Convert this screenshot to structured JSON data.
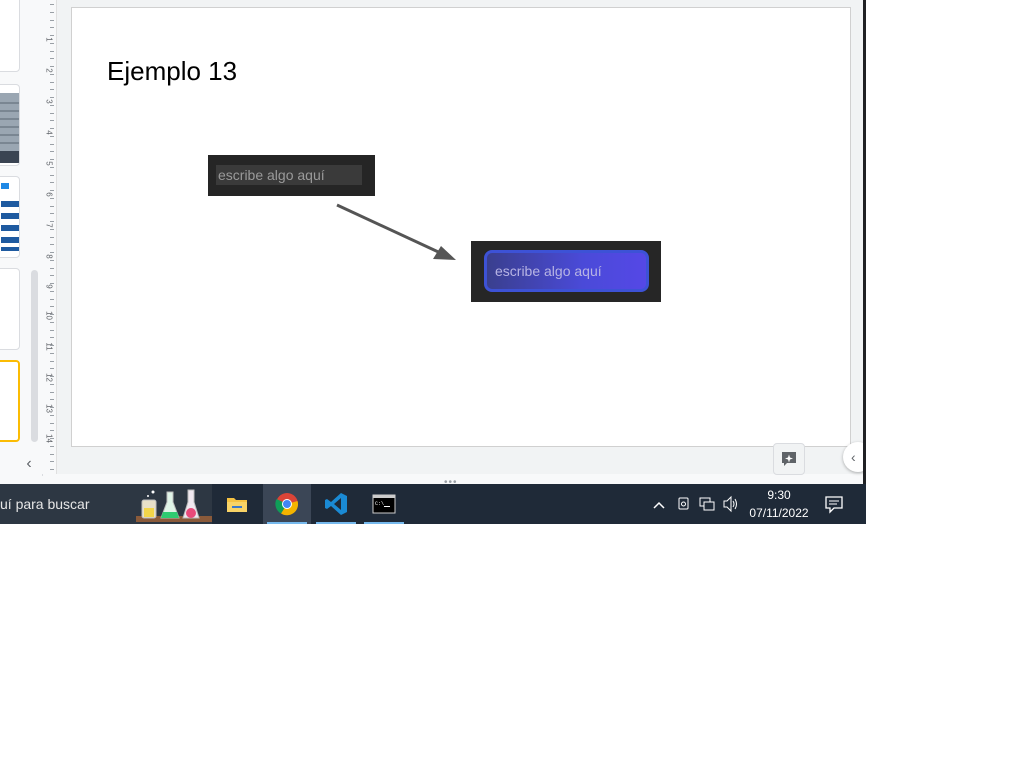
{
  "slide": {
    "title": "Ejemplo 13",
    "input_before": {
      "placeholder": "escribe algo aquí"
    },
    "input_after": {
      "placeholder": "escribe algo aquí"
    }
  },
  "ruler": {
    "numbers": [
      "1",
      "2",
      "3",
      "4",
      "5",
      "6",
      "7",
      "8",
      "9",
      "10",
      "11",
      "12",
      "13",
      "14"
    ]
  },
  "taskbar": {
    "search_text": "uí para buscar",
    "apps": [
      "file-explorer",
      "chrome",
      "vscode",
      "terminal"
    ],
    "clock_time": "9:30",
    "clock_date": "07/11/2022"
  },
  "colors": {
    "taskbar": "#1f2a38",
    "selected_thumb_border": "#fbbc04",
    "input_gradient_end": "#5548e6",
    "input_border": "#3d52d6"
  }
}
